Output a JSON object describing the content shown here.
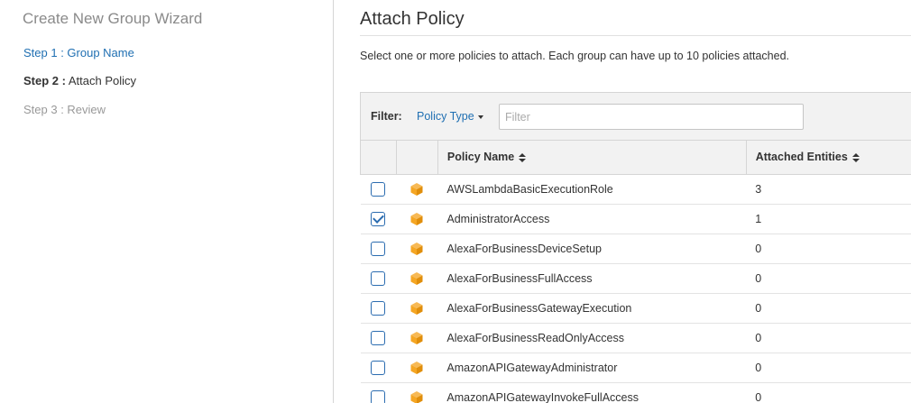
{
  "sidebar": {
    "title": "Create New Group Wizard",
    "step1": "Step 1 : Group Name",
    "step2_prefix": "Step 2 :",
    "step2_label": "Attach Policy",
    "step3": "Step 3 : Review"
  },
  "main": {
    "title": "Attach Policy",
    "description": "Select one or more policies to attach. Each group can have up to 10 policies attached.",
    "filter": {
      "label": "Filter:",
      "policy_type": "Policy Type",
      "placeholder": "Filter"
    },
    "table": {
      "headers": {
        "name": "Policy Name",
        "entities": "Attached Entities"
      },
      "rows": [
        {
          "name": "AWSLambdaBasicExecutionRole",
          "entities": "3",
          "checked": false
        },
        {
          "name": "AdministratorAccess",
          "entities": "1",
          "checked": true
        },
        {
          "name": "AlexaForBusinessDeviceSetup",
          "entities": "0",
          "checked": false
        },
        {
          "name": "AlexaForBusinessFullAccess",
          "entities": "0",
          "checked": false
        },
        {
          "name": "AlexaForBusinessGatewayExecution",
          "entities": "0",
          "checked": false
        },
        {
          "name": "AlexaForBusinessReadOnlyAccess",
          "entities": "0",
          "checked": false
        },
        {
          "name": "AmazonAPIGatewayAdministrator",
          "entities": "0",
          "checked": false
        },
        {
          "name": "AmazonAPIGatewayInvokeFullAccess",
          "entities": "0",
          "checked": false
        }
      ]
    }
  },
  "colors": {
    "link": "#1f6fb2",
    "checkbox": "#2b6cb0",
    "policy_icon": "#f5a623"
  },
  "icons": {
    "policy": "aws-policy-cube-icon",
    "sort": "sort-arrows-icon",
    "dropdown": "caret-down-icon"
  }
}
